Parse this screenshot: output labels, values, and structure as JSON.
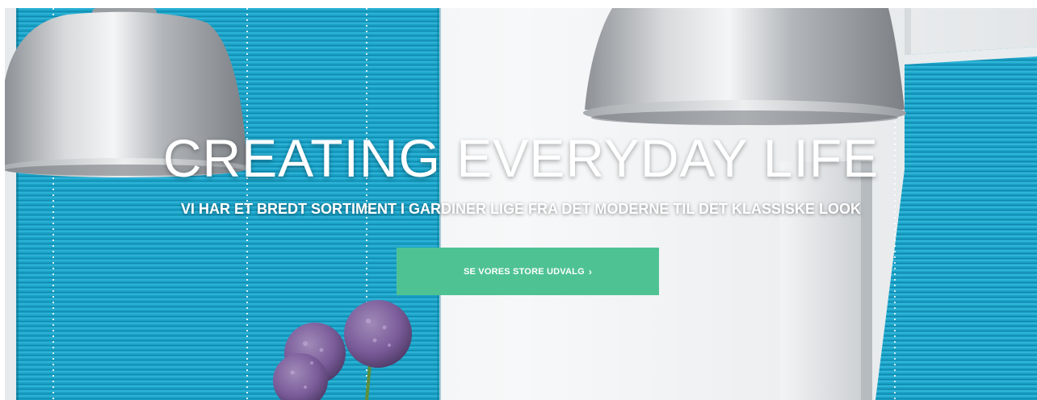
{
  "hero": {
    "headline": "CREATING EVERYDAY LIFE",
    "subheadline": "VI HAR ET BREDT SORTIMENT I GARDINER LIGE FRA DET MODERNE TIL DET KLASSISKE LOOK",
    "cta_label": "SE VORES STORE UDVALG",
    "cta_icon": "chevron-right-icon"
  },
  "colors": {
    "blind_blue": "#1aa1c6",
    "cta_green": "#4fc294",
    "lamp_silver": "#c4c7ca",
    "allium_purple": "#7b5c9a"
  }
}
